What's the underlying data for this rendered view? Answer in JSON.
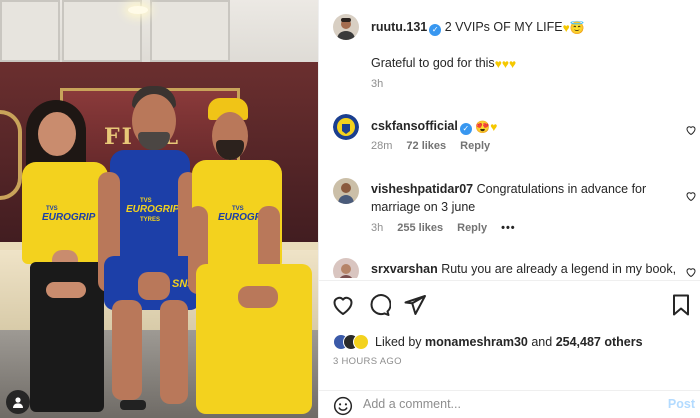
{
  "photo": {
    "banner_text": "FI AL",
    "jersey_brand": "EUROGRIP",
    "jersey_sub": "TVS",
    "jersey_tires": "TYRES",
    "sponsor_short": "SNJ"
  },
  "post": {
    "author": "ruutu.131",
    "caption_text": "2 VVIPs OF MY LIFE",
    "caption_line2": "Grateful to god for this",
    "time_ago": "3h"
  },
  "comments": [
    {
      "username": "cskfansofficial",
      "text": "",
      "time": "28m",
      "likes": "72 likes",
      "reply": "Reply",
      "verified": true
    },
    {
      "username": "visheshpatidar07",
      "text": "Congratulations in advance for marriage on 3 june",
      "time": "3h",
      "likes": "255 likes",
      "reply": "Reply",
      "more": "•••"
    },
    {
      "username": "srxvarshan",
      "text": "Rutu you are already a legend in my book, this"
    }
  ],
  "likes": {
    "liked_by_label": "Liked by",
    "liked_by_user": "monameshram30",
    "and_label": "and",
    "others": "254,487 others"
  },
  "posted_ago": "3 HOURS AGO",
  "add_comment": {
    "placeholder": "Add a comment...",
    "post_label": "Post"
  },
  "colors": {
    "verified": "#3897f0",
    "csk_yellow": "#f3d21e",
    "csk_blue": "#1c3fa8"
  }
}
